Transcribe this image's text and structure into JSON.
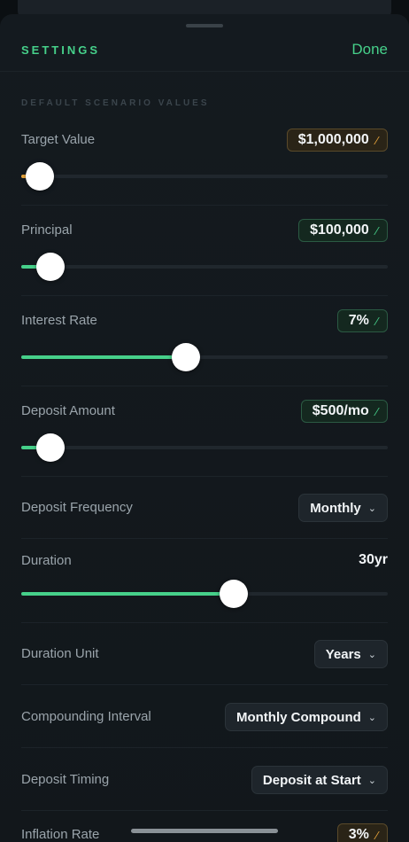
{
  "header": {
    "title": "SETTINGS",
    "done_label": "Done"
  },
  "section": {
    "label": "DEFAULT SCENARIO VALUES"
  },
  "target_value": {
    "label": "Target Value",
    "value": "$1,000,000",
    "slider_fraction": 0.05
  },
  "principal": {
    "label": "Principal",
    "value": "$100,000",
    "slider_fraction": 0.08
  },
  "interest_rate": {
    "label": "Interest Rate",
    "value": "7%",
    "slider_fraction": 0.45
  },
  "deposit_amount": {
    "label": "Deposit Amount",
    "value": "$500/mo",
    "slider_fraction": 0.08
  },
  "deposit_frequency": {
    "label": "Deposit Frequency",
    "value": "Monthly"
  },
  "duration": {
    "label": "Duration",
    "value": "30yr",
    "slider_fraction": 0.58
  },
  "duration_unit": {
    "label": "Duration Unit",
    "value": "Years"
  },
  "compounding_interval": {
    "label": "Compounding Interval",
    "value": "Monthly Compound"
  },
  "deposit_timing": {
    "label": "Deposit Timing",
    "value": "Deposit at Start"
  },
  "inflation_rate": {
    "label": "Inflation Rate",
    "value": "3%"
  },
  "icons": {
    "edit": "pencil-icon",
    "dropdown": "chevron-down-icon"
  },
  "colors": {
    "accent": "#46d08a",
    "warning": "#e8a53b",
    "background": "#12171b"
  }
}
